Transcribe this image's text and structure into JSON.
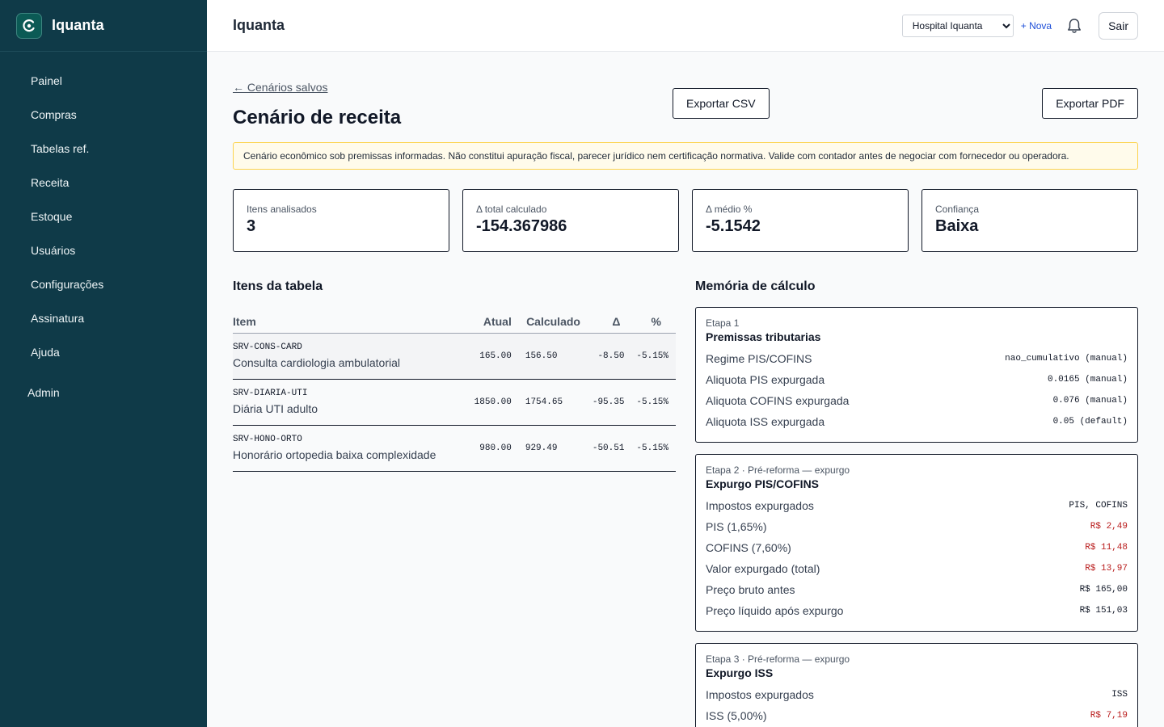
{
  "app": {
    "brand": "Iquanta",
    "page_header": "Iquanta"
  },
  "sidebar": {
    "items": [
      {
        "label": "Painel"
      },
      {
        "label": "Compras"
      },
      {
        "label": "Tabelas ref."
      },
      {
        "label": "Receita"
      },
      {
        "label": "Estoque"
      },
      {
        "label": "Usuários"
      },
      {
        "label": "Configurações"
      },
      {
        "label": "Assinatura"
      },
      {
        "label": "Ajuda"
      }
    ],
    "admin_label": "Admin"
  },
  "topbar": {
    "tenant_selected": "Hospital Iquanta",
    "new_label": "+ Nova",
    "logout_label": "Sair"
  },
  "page": {
    "back_link": "← Cenários salvos",
    "title": "Cenário de receita",
    "export_csv": "Exportar CSV",
    "export_pdf": "Exportar PDF",
    "disclaimer": "Cenário econômico sob premissas informadas. Não constitui apuração fiscal, parecer jurídico nem certificação normativa. Valide com contador antes de negociar com fornecedor ou operadora."
  },
  "metrics": [
    {
      "label": "Itens analisados",
      "value": "3"
    },
    {
      "label": "Δ total calculado",
      "value": "-154.367986"
    },
    {
      "label": "Δ médio %",
      "value": "-5.1542"
    },
    {
      "label": "Confiança",
      "value": "Baixa"
    }
  ],
  "table": {
    "title": "Itens da tabela",
    "headers": {
      "item": "Item",
      "atual": "Atual",
      "calculado": "Calculado",
      "delta": "Δ",
      "pct": "%"
    },
    "rows": [
      {
        "code": "SRV-CONS-CARD",
        "desc": "Consulta cardiologia ambulatorial",
        "atual": "165.00",
        "calculado": "156.50",
        "delta": "-8.50",
        "pct": "-5.15%"
      },
      {
        "code": "SRV-DIARIA-UTI",
        "desc": "Diária UTI adulto",
        "atual": "1850.00",
        "calculado": "1754.65",
        "delta": "-95.35",
        "pct": "-5.15%"
      },
      {
        "code": "SRV-HONO-ORTO",
        "desc": "Honorário ortopedia baixa complexidade",
        "atual": "980.00",
        "calculado": "929.49",
        "delta": "-50.51",
        "pct": "-5.15%"
      }
    ]
  },
  "memoria": {
    "title": "Memória de cálculo",
    "steps": [
      {
        "label": "Etapa 1",
        "title": "Premissas tributarias",
        "rows": [
          {
            "k": "Regime PIS/COFINS",
            "v": "nao_cumulativo (manual)"
          },
          {
            "k": "Aliquota PIS expurgada",
            "v": "0.0165 (manual)"
          },
          {
            "k": "Aliquota COFINS expurgada",
            "v": "0.076 (manual)"
          },
          {
            "k": "Aliquota ISS expurgada",
            "v": "0.05 (default)"
          }
        ]
      },
      {
        "label": "Etapa 2 · Pré-reforma — expurgo",
        "title": "Expurgo PIS/COFINS",
        "rows": [
          {
            "k": "Impostos expurgados",
            "v": "PIS, COFINS"
          },
          {
            "k": "PIS (1,65%)",
            "v": "R$ 2,49"
          },
          {
            "k": "COFINS (7,60%)",
            "v": "R$ 11,48"
          },
          {
            "k": "Valor expurgado (total)",
            "v": "R$ 13,97"
          },
          {
            "k": "Preço bruto antes",
            "v": "R$ 165,00"
          },
          {
            "k": "Preço líquido após expurgo",
            "v": "R$ 151,03"
          }
        ]
      },
      {
        "label": "Etapa 3 · Pré-reforma — expurgo",
        "title": "Expurgo ISS",
        "rows": [
          {
            "k": "Impostos expurgados",
            "v": "ISS"
          },
          {
            "k": "ISS (5,00%)",
            "v": "R$ 7,19"
          }
        ]
      }
    ]
  },
  "colors": {
    "sidebar_bg": "#0f3a48",
    "negative": "#b91c1c",
    "warning_bg": "#fffbeb"
  }
}
